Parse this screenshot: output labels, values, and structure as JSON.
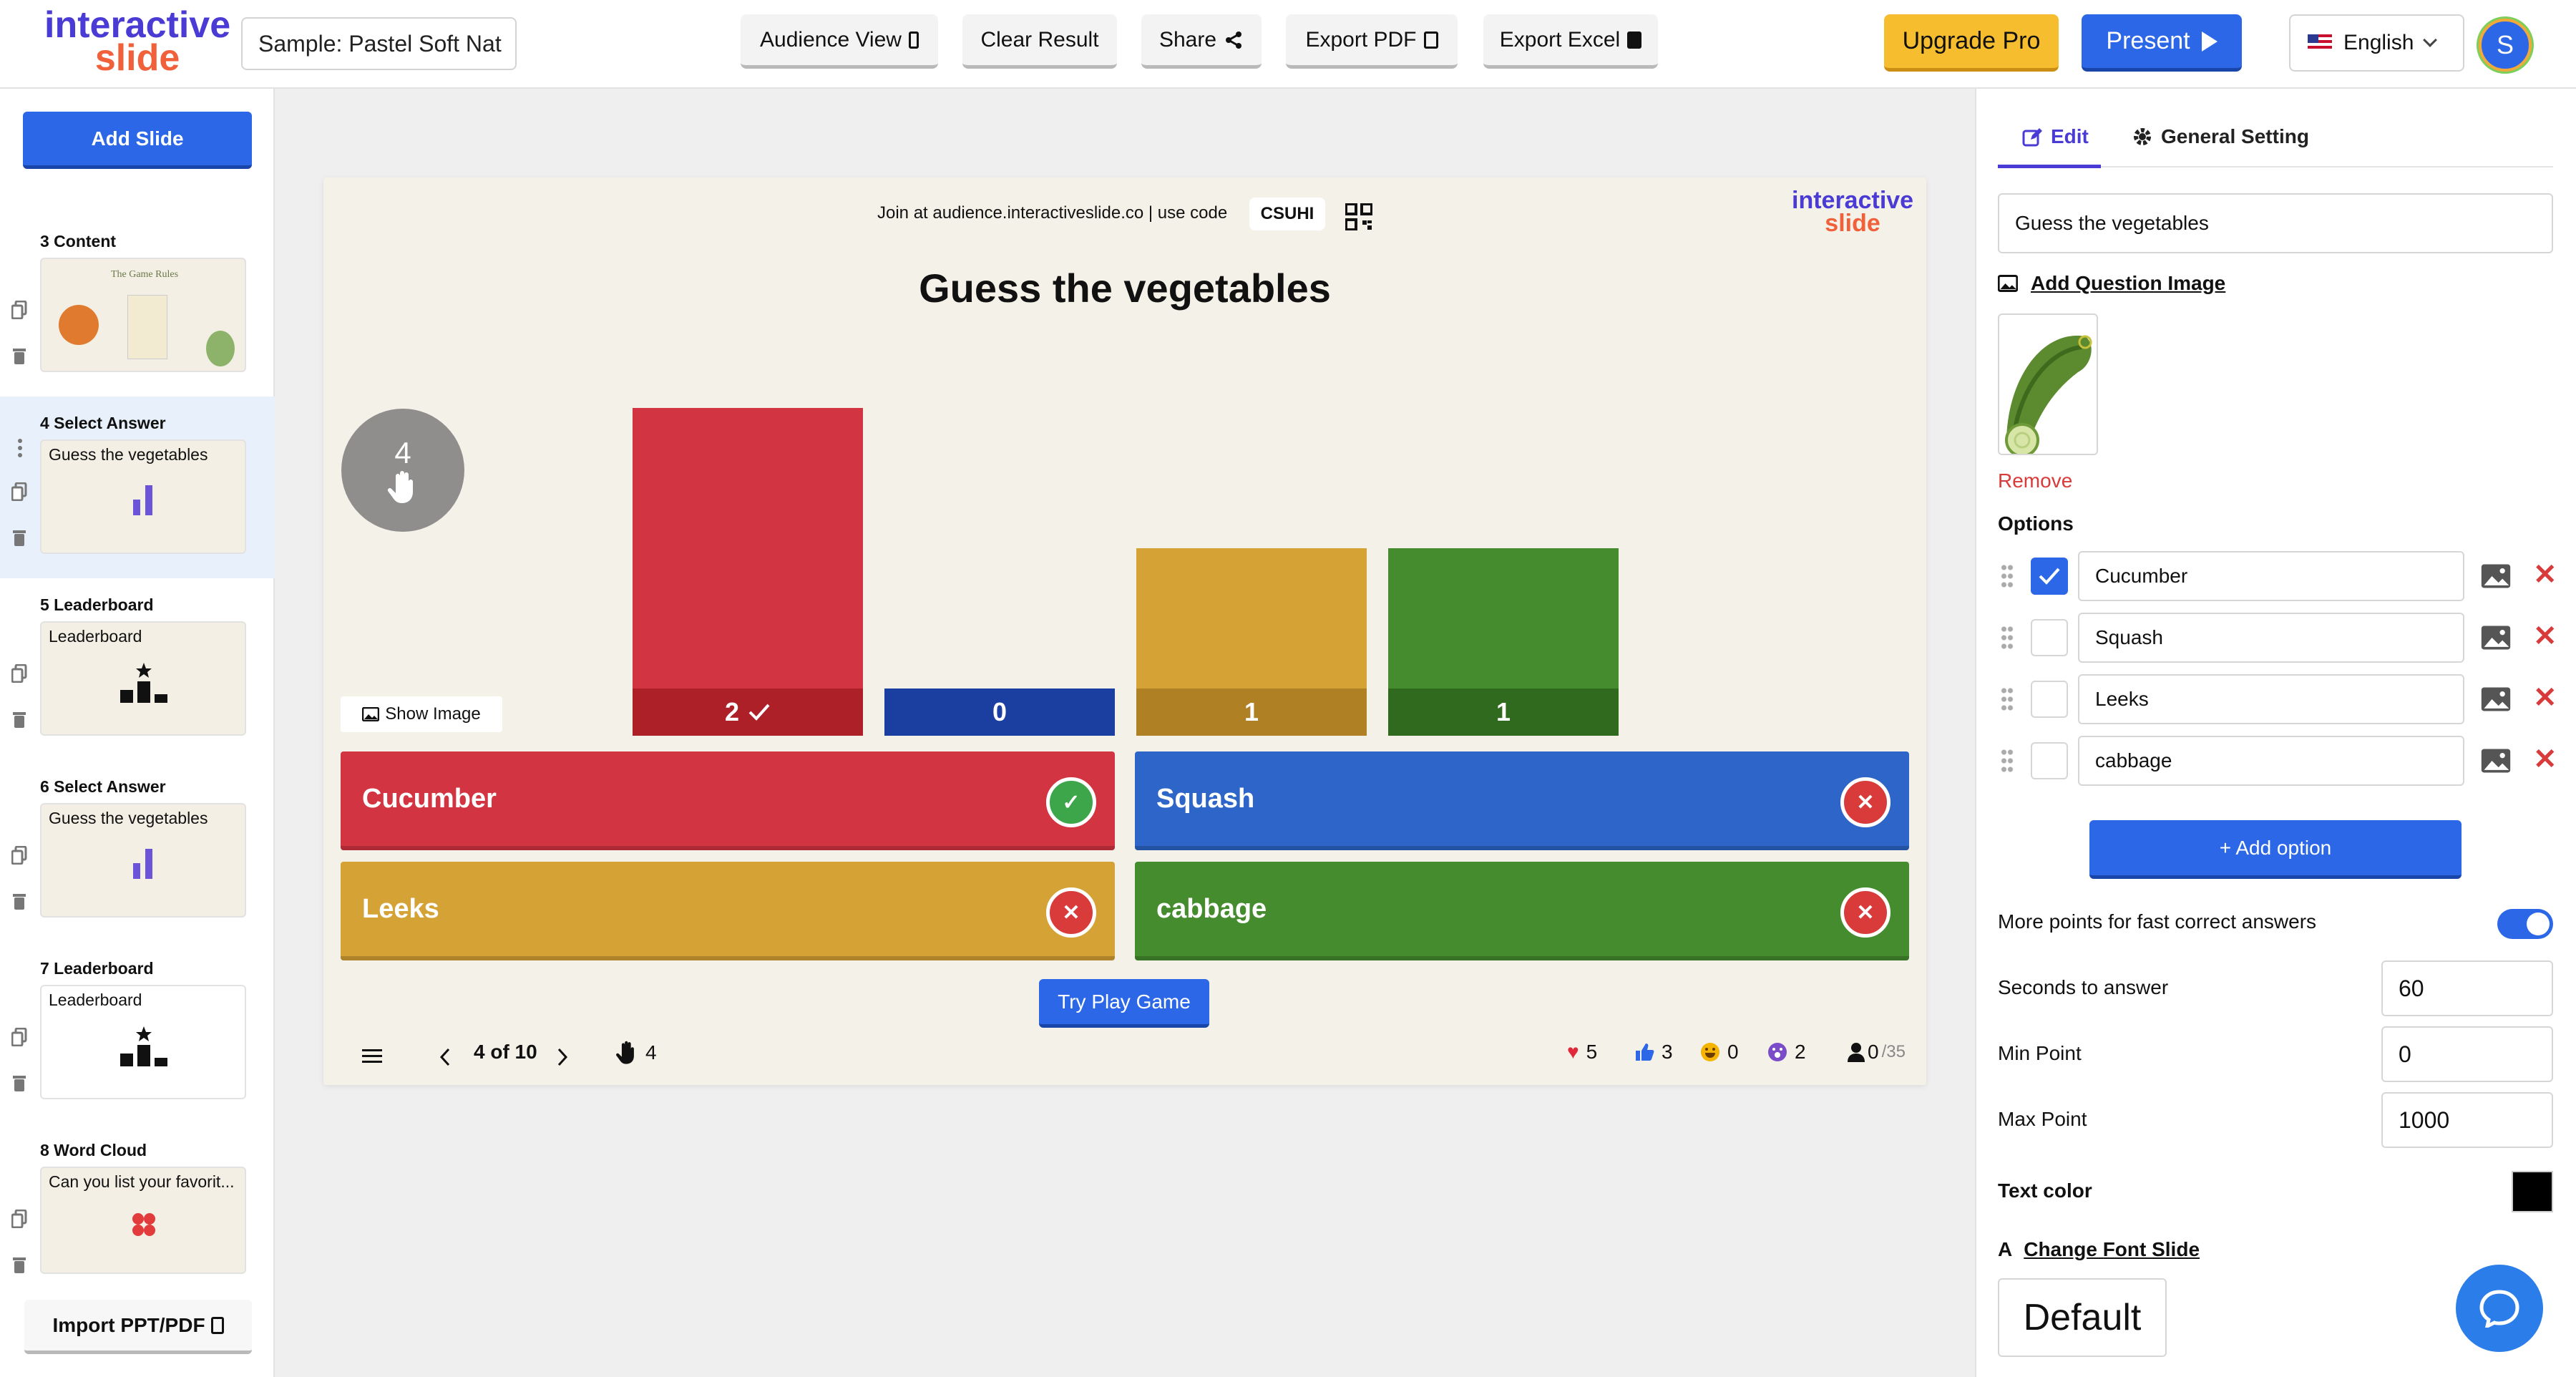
{
  "app": {
    "logo_line1": "interactive",
    "logo_line2": "slide",
    "presentation_name": "Sample: Pastel Soft Nat"
  },
  "toolbar": {
    "audience_view": "Audience View",
    "clear_result": "Clear Result",
    "share": "Share",
    "export_pdf": "Export PDF",
    "export_excel": "Export Excel",
    "upgrade": "Upgrade Pro",
    "present": "Present",
    "language": "English",
    "avatar_initial": "S"
  },
  "sidebar": {
    "add_slide": "Add Slide",
    "import": "Import PPT/PDF",
    "slides": [
      {
        "title": "3 Content",
        "preview": "The Game Rules",
        "kind": "content"
      },
      {
        "title": "4 Select Answer",
        "preview": "Guess the vegetables",
        "kind": "chart",
        "active": true
      },
      {
        "title": "5 Leaderboard",
        "preview": "Leaderboard",
        "kind": "podium"
      },
      {
        "title": "6 Select Answer",
        "preview": "Guess the vegetables",
        "kind": "chart"
      },
      {
        "title": "7 Leaderboard",
        "preview": "Leaderboard",
        "kind": "podium"
      },
      {
        "title": "8 Word Cloud",
        "preview": "Can you list your favorit...",
        "kind": "cloud"
      }
    ]
  },
  "slide": {
    "join_text": "Join at audience.interactiveslide.co | use code",
    "code": "CSUHI",
    "logo_line1": "interactive",
    "logo_line2": "slide",
    "question": "Guess the vegetables",
    "timer_value": "4",
    "show_image": "Show Image",
    "try_play": "Try Play Game",
    "page_indicator": "4 of 10",
    "hands": "4",
    "reactions": {
      "hearts": "5",
      "likes": "3",
      "laughs": "0",
      "wows": "2"
    },
    "participants": "0",
    "participants_total": "/35"
  },
  "chart_data": {
    "type": "bar",
    "categories": [
      "Cucumber",
      "Squash",
      "Leeks",
      "cabbage"
    ],
    "values": [
      2,
      0,
      1,
      1
    ],
    "correct": [
      true,
      false,
      false,
      false
    ],
    "colors": [
      "#d33442",
      "#2d66c8",
      "#d4a235",
      "#458c2e"
    ],
    "count_colors": [
      "#ad2028",
      "#1a3fa0",
      "#b08025",
      "#2f6a1f"
    ]
  },
  "options": [
    {
      "label": "Cucumber",
      "correct": true,
      "color": "#d33442"
    },
    {
      "label": "Squash",
      "correct": false,
      "color": "#2d66c8"
    },
    {
      "label": "Leeks",
      "correct": false,
      "color": "#d4a235"
    },
    {
      "label": "cabbage",
      "correct": false,
      "color": "#458c2e"
    }
  ],
  "panel": {
    "tab_edit": "Edit",
    "tab_general": "General Setting",
    "question_value": "Guess the vegetables",
    "add_question_image": "Add Question Image",
    "remove": "Remove",
    "options_label": "Options",
    "add_option": "+ Add option",
    "fast_points_label": "More points for fast correct answers",
    "fast_points_enabled": true,
    "seconds_label": "Seconds to answer",
    "seconds_value": "60",
    "min_label": "Min Point",
    "min_value": "0",
    "max_label": "Max Point",
    "max_value": "1000",
    "text_color_label": "Text color",
    "text_color": "#000000",
    "change_font": "Change Font Slide",
    "font_value": "Default"
  }
}
